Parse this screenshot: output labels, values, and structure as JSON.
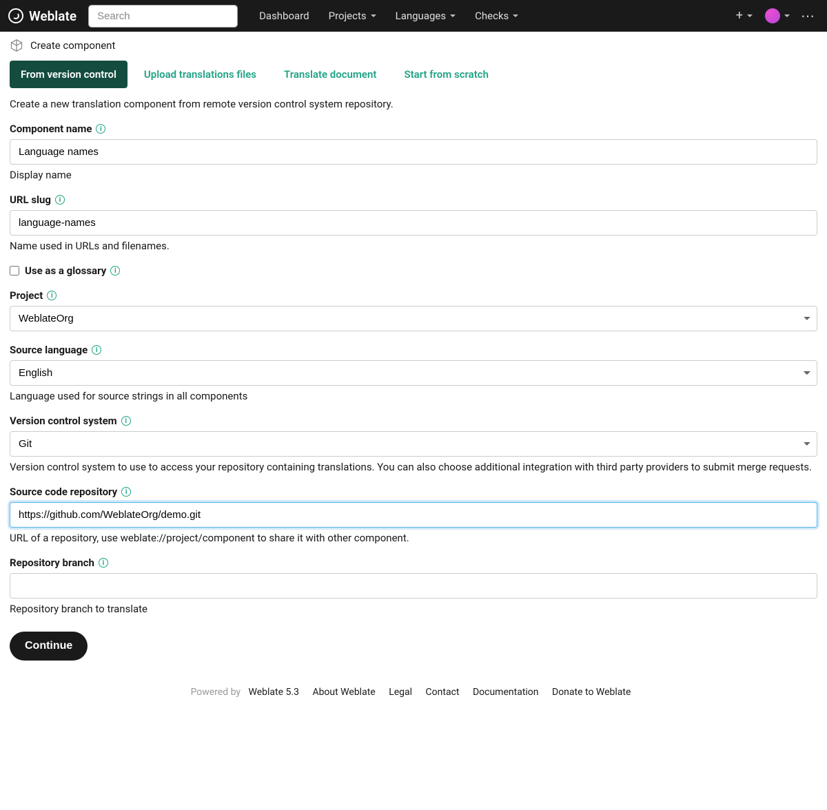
{
  "brand": "Weblate",
  "search": {
    "placeholder": "Search"
  },
  "nav": {
    "dashboard": "Dashboard",
    "projects": "Projects",
    "languages": "Languages",
    "checks": "Checks"
  },
  "breadcrumb": {
    "title": "Create component"
  },
  "tabs": {
    "from_vcs": "From version control",
    "upload": "Upload translations files",
    "translate_doc": "Translate document",
    "scratch": "Start from scratch"
  },
  "intro": "Create a new translation component from remote version control system repository.",
  "fields": {
    "component_name": {
      "label": "Component name",
      "value": "Language names",
      "help": "Display name"
    },
    "url_slug": {
      "label": "URL slug",
      "value": "language-names",
      "help": "Name used in URLs and filenames."
    },
    "glossary": {
      "label": "Use as a glossary",
      "checked": false
    },
    "project": {
      "label": "Project",
      "value": "WeblateOrg"
    },
    "source_language": {
      "label": "Source language",
      "value": "English",
      "help": "Language used for source strings in all components"
    },
    "vcs": {
      "label": "Version control system",
      "value": "Git",
      "help": "Version control system to use to access your repository containing translations. You can also choose additional integration with third party providers to submit merge requests."
    },
    "repo": {
      "label": "Source code repository",
      "value": "https://github.com/WeblateOrg/demo.git",
      "help": "URL of a repository, use weblate://project/component to share it with other component."
    },
    "branch": {
      "label": "Repository branch",
      "value": "",
      "help": "Repository branch to translate"
    }
  },
  "continue": "Continue",
  "footer": {
    "powered_by": "Powered by ",
    "weblate": "Weblate 5.3",
    "about": "About Weblate",
    "legal": "Legal",
    "contact": "Contact",
    "docs": "Documentation",
    "donate": "Donate to Weblate"
  }
}
